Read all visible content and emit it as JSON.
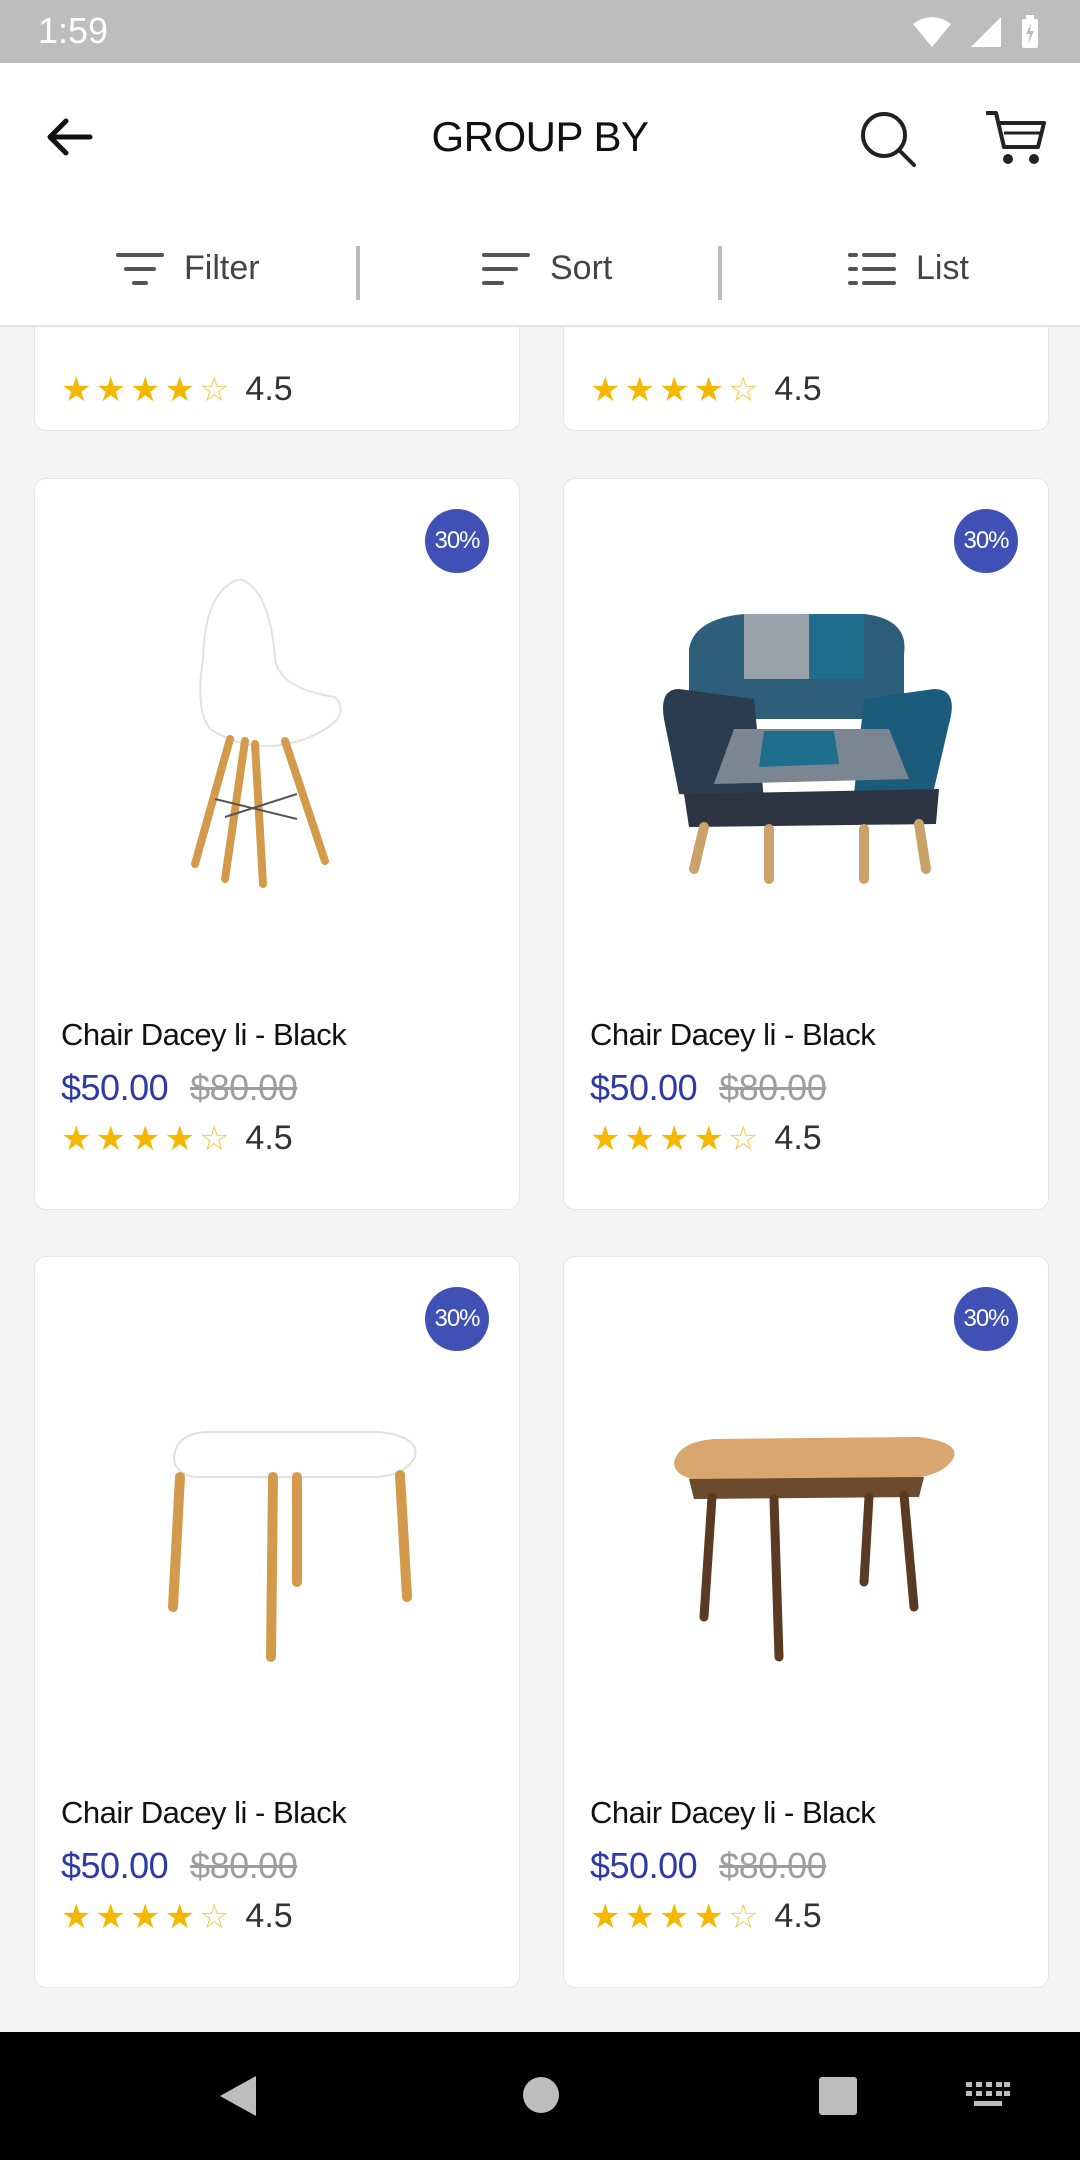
{
  "status_bar": {
    "time": "1:59"
  },
  "app_bar": {
    "title": "GROUP BY"
  },
  "toolbar": {
    "filter_label": "Filter",
    "sort_label": "Sort",
    "list_label": "List"
  },
  "partial_row": [
    {
      "rating": "4.5",
      "stars": 4
    },
    {
      "rating": "4.5",
      "stars": 4
    }
  ],
  "products": [
    {
      "name": "Chair Dacey li - Black",
      "price": "$50.00",
      "old_price": "$80.00",
      "discount": "30%",
      "rating": "4.5",
      "stars": 4,
      "image": "white-chair"
    },
    {
      "name": "Chair Dacey li - Black",
      "price": "$50.00",
      "old_price": "$80.00",
      "discount": "30%",
      "rating": "4.5",
      "stars": 4,
      "image": "patchwork-armchair"
    },
    {
      "name": "Chair Dacey li - Black",
      "price": "$50.00",
      "old_price": "$80.00",
      "discount": "30%",
      "rating": "4.5",
      "stars": 4,
      "image": "white-table"
    },
    {
      "name": "Chair Dacey li - Black",
      "price": "$50.00",
      "old_price": "$80.00",
      "discount": "30%",
      "rating": "4.5",
      "stars": 4,
      "image": "wood-table"
    }
  ],
  "colors": {
    "accent": "#3f51b5",
    "price": "#2e3aa6",
    "star": "#f5b800"
  }
}
